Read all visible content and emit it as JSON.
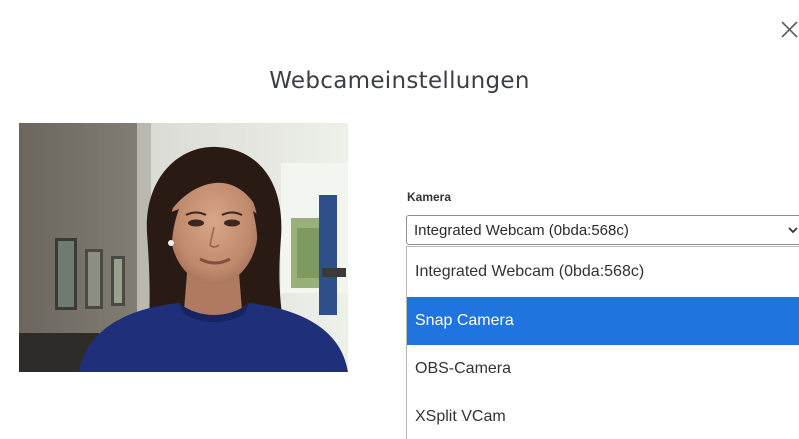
{
  "dialog": {
    "title": "Webcameinstellungen",
    "close_icon": "close-icon"
  },
  "camera": {
    "label": "Kamera",
    "selected_value": "Integrated Webcam (0bda:568c)",
    "options": [
      {
        "label": "Integrated Webcam (0bda:568c)"
      },
      {
        "label": "Snap Camera"
      },
      {
        "label": "OBS-Camera"
      },
      {
        "label": "XSplit VCam"
      }
    ],
    "highlighted_option": "Snap Camera",
    "dropdown_icon": "chevron-down-icon"
  },
  "colors": {
    "highlight": "#1f74e0",
    "title_text": "#3a3f45",
    "border": "#8e8e8e"
  }
}
